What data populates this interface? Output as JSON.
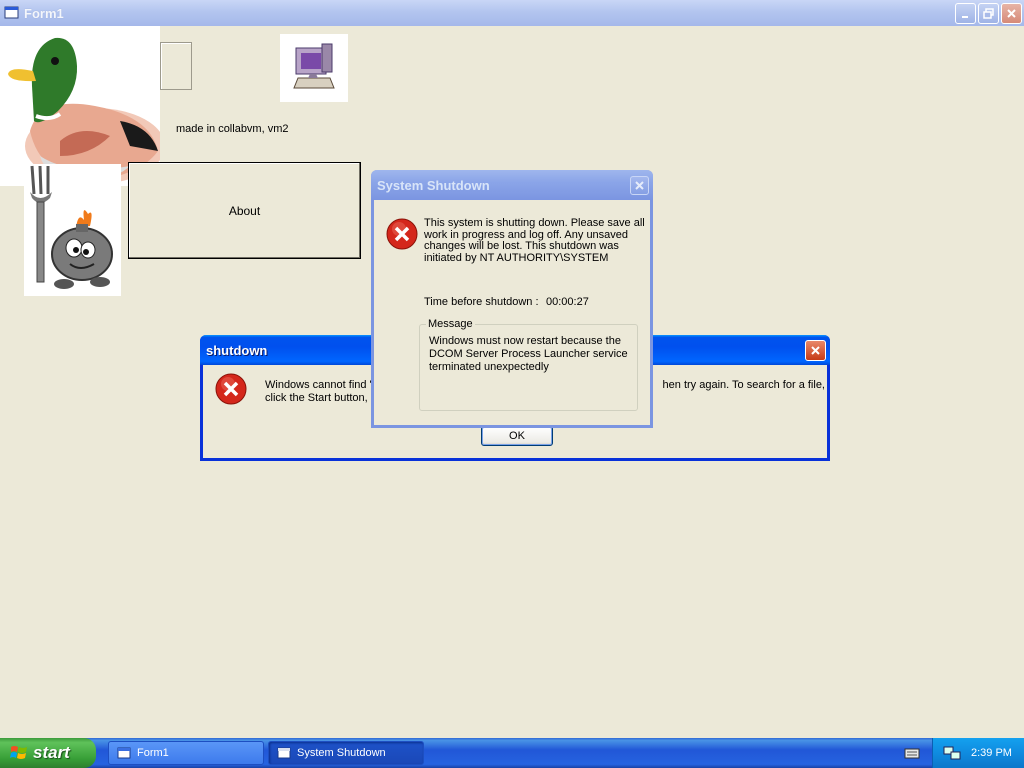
{
  "form": {
    "title": "Form1",
    "made_label": "made in collabvm, vm2",
    "about_label": "About"
  },
  "shutdown_box": {
    "title": "shutdown",
    "message_left": "Windows cannot find '",
    "message_right": "hen try again. To search for a file,",
    "message_line2": "click the Start button,",
    "ok_label": "OK"
  },
  "system_shutdown": {
    "title": "System Shutdown",
    "body": "This system is shutting down. Please save all work in progress and log off. Any unsaved changes will be lost. This shutdown was initiated by NT AUTHORITY\\SYSTEM",
    "time_label": "Time before shutdown :",
    "time_value": "00:00:27",
    "message_legend": "Message",
    "message_text": "Windows must now restart because the DCOM Server Process Launcher service terminated unexpectedly"
  },
  "taskbar": {
    "start_label": "start",
    "tasks": [
      {
        "label": "Form1",
        "icon": "window-icon"
      },
      {
        "label": "System Shutdown",
        "icon": "window-icon"
      }
    ],
    "clock": "2:39 PM"
  },
  "colors": {
    "xp_blue": "#0053ee",
    "error_red": "#d4271b",
    "desktop_bg": "#ece9d8"
  }
}
